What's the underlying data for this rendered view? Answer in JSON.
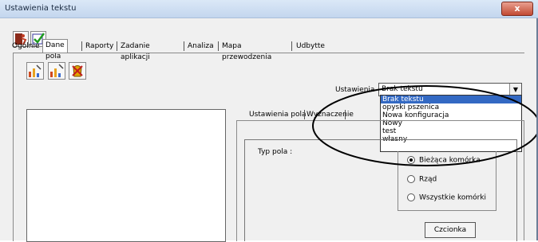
{
  "window": {
    "title": "Ustawienia tekstu",
    "close_glyph": "x"
  },
  "toolbar": {
    "icons": [
      "exit-icon",
      "check-icon"
    ]
  },
  "tabs": [
    "Ogólnie",
    "Dane pola",
    "Raporty",
    "Zadanie aplikacji",
    "Analiza",
    "Mapa przewodzenia",
    "Udbytte"
  ],
  "active_tab": "Dane pola",
  "subtoolbar": {
    "icons": [
      "edit-chart-icon",
      "new-chart-icon",
      "delete-icon"
    ]
  },
  "settings": {
    "label": "Ustawienia",
    "selected": "Brak tekstu",
    "options": [
      "Brak tekstu",
      "opyski pszenica",
      "Nowa konfiguracja",
      "Nowy",
      "test",
      "własny"
    ]
  },
  "inner_tabs": [
    "Ustawienia pola",
    "Wyznaczenie"
  ],
  "field_type": {
    "label": "Typ pola :",
    "options": [
      "Bieżąca komórka",
      "Rząd",
      "Wszystkie komórki"
    ],
    "selected": "Bieżąca komórka"
  },
  "font_button": "Czcionka",
  "colors": {
    "selection": "#3369c3",
    "close": "#c24a33"
  }
}
